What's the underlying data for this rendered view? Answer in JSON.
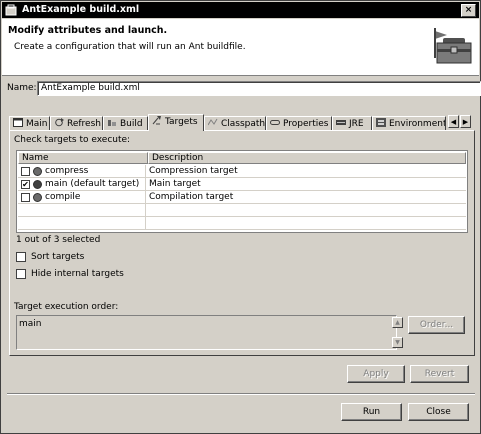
{
  "window": {
    "title": "AntExample build.xml",
    "close_glyph": "×"
  },
  "header": {
    "title": "Modify attributes and launch.",
    "message": "Create a configuration that will run an Ant buildfile.",
    "image_icon": "ant-toolbox-icon"
  },
  "name": {
    "label": "Name:",
    "value": "AntExample build.xml"
  },
  "tabs": [
    {
      "label": "Main",
      "icon": "main-tab-icon"
    },
    {
      "label": "Refresh",
      "icon": "refresh-icon"
    },
    {
      "label": "Build",
      "icon": "build-icon"
    },
    {
      "label": "Targets",
      "icon": "targets-icon",
      "selected": true
    },
    {
      "label": "Classpath",
      "icon": "classpath-icon"
    },
    {
      "label": "Properties",
      "icon": "properties-icon"
    },
    {
      "label": "JRE",
      "icon": "jre-icon"
    },
    {
      "label": "Environment",
      "icon": "environment-icon"
    }
  ],
  "tab_scroll": {
    "left": "◀",
    "right": "▶"
  },
  "targets": {
    "heading": "Check targets to execute:",
    "columns": [
      "Name",
      "Description"
    ],
    "rows": [
      {
        "name": "compress",
        "description": "Compression target",
        "checked": false
      },
      {
        "name": "main (default target)",
        "description": "Main target",
        "checked": true
      },
      {
        "name": "compile",
        "description": "Compilation target",
        "checked": false
      }
    ],
    "check_glyph": "✔",
    "status": "1 out of 3 selected",
    "sort_label": "Sort targets",
    "hide_label": "Hide internal targets",
    "order_label": "Target execution order:",
    "order_value": "main",
    "order_button": "Order...",
    "scroll_up": "▲",
    "scroll_down": "▼"
  },
  "buttons": {
    "apply": "Apply",
    "revert": "Revert",
    "run": "Run",
    "close": "Close"
  }
}
